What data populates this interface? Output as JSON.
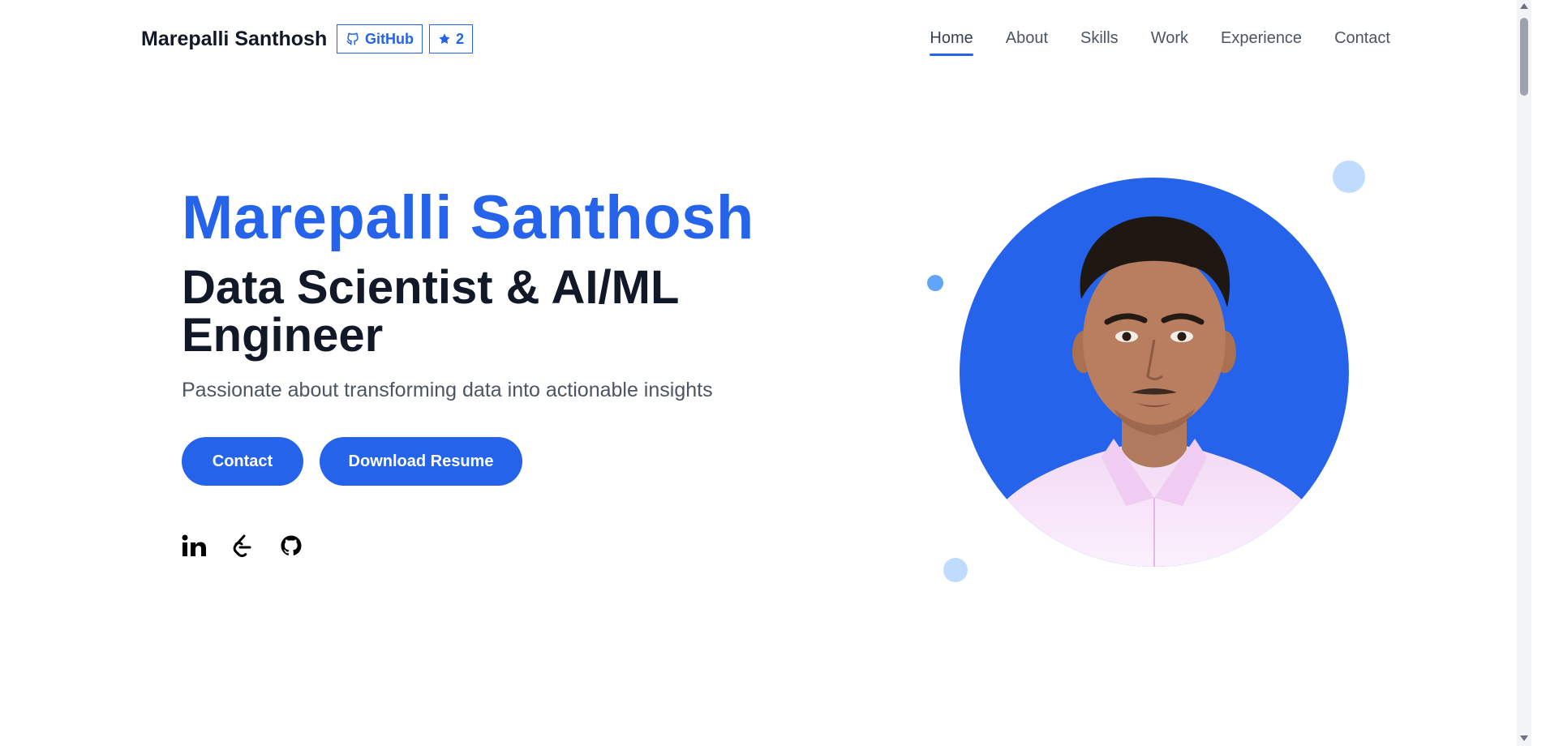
{
  "header": {
    "brand": "Marepalli Santhosh",
    "github_label": "GitHub",
    "stars": "2",
    "nav": [
      {
        "label": "Home",
        "active": true
      },
      {
        "label": "About"
      },
      {
        "label": "Skills"
      },
      {
        "label": "Work"
      },
      {
        "label": "Experience"
      },
      {
        "label": "Contact"
      }
    ]
  },
  "hero": {
    "name": "Marepalli Santhosh",
    "role": "Data Scientist & AI/ML Engineer",
    "tagline": "Passionate about transforming data into actionable insights",
    "contact_label": "Contact",
    "resume_label": "Download Resume",
    "socials": [
      "linkedin-icon",
      "leetcode-icon",
      "github-icon"
    ]
  },
  "colors": {
    "accent": "#2563eb",
    "text": "#111827",
    "muted": "#4b5563",
    "light_dot": "#bfdbfe",
    "mid_dot": "#60a5fa"
  }
}
